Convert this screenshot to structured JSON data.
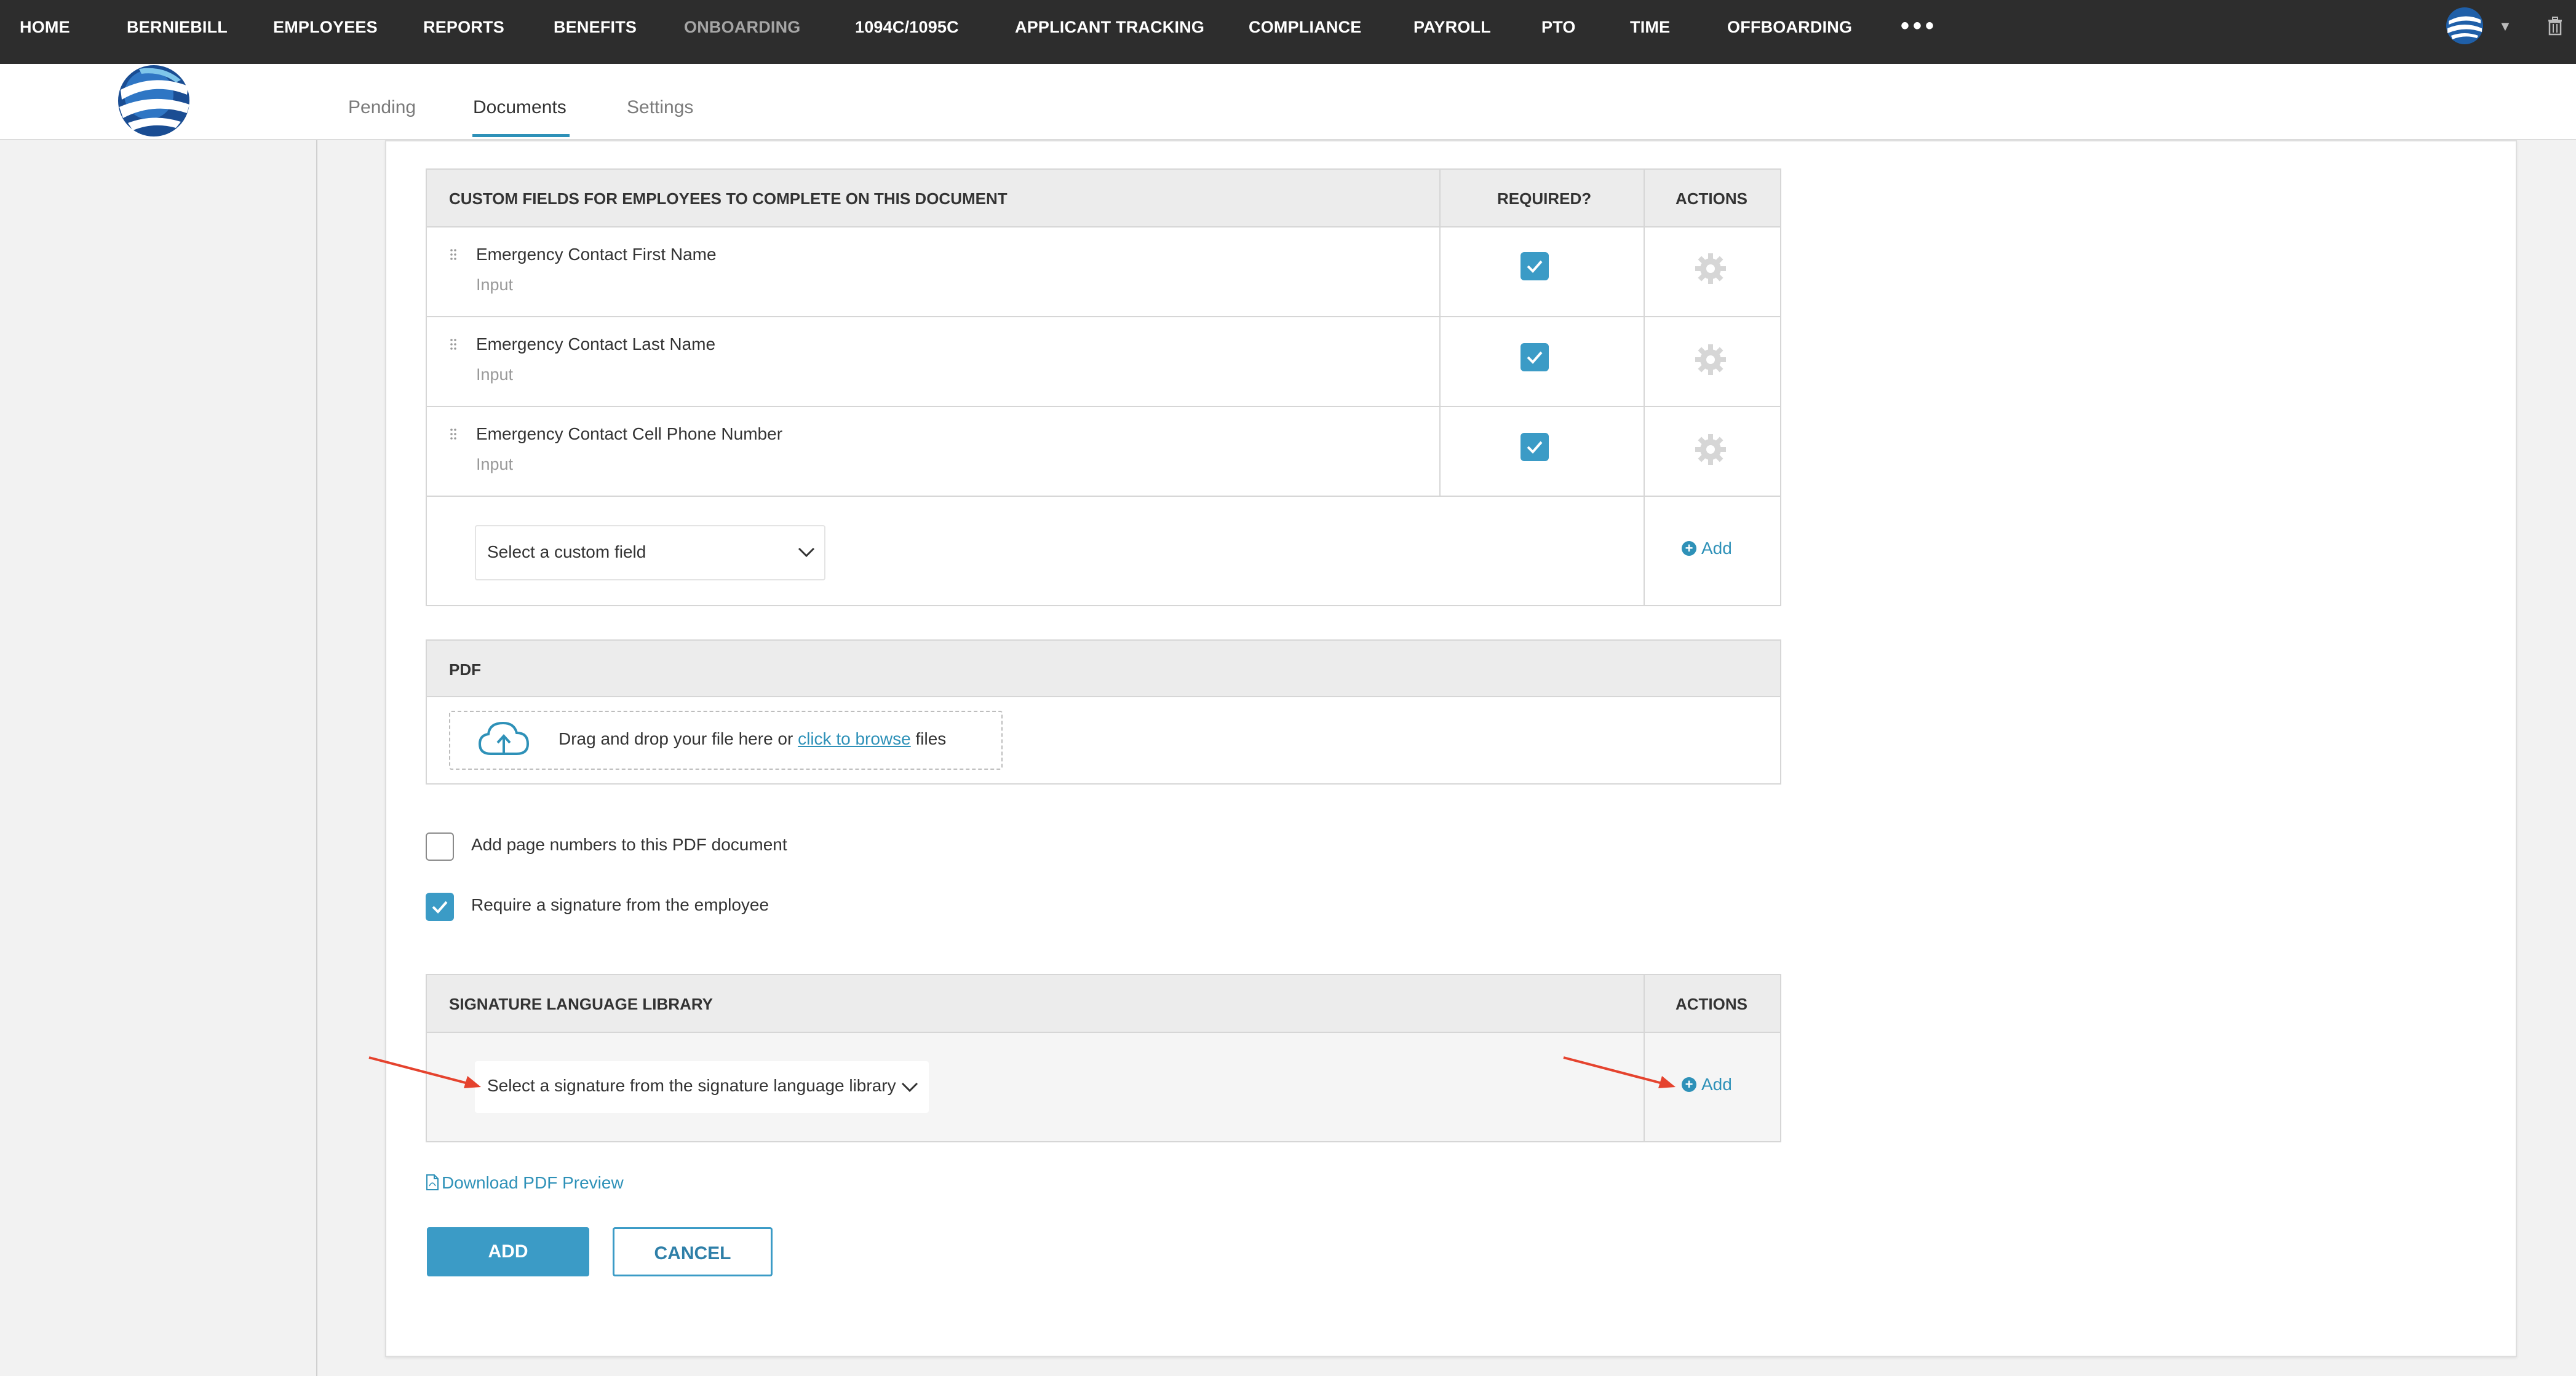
{
  "nav": {
    "items": [
      {
        "label": "HOME"
      },
      {
        "label": "BERNIEBILL"
      },
      {
        "label": "EMPLOYEES"
      },
      {
        "label": "REPORTS"
      },
      {
        "label": "BENEFITS"
      },
      {
        "label": "ONBOARDING"
      },
      {
        "label": "1094C/1095C"
      },
      {
        "label": "APPLICANT TRACKING"
      },
      {
        "label": "COMPLIANCE"
      },
      {
        "label": "PAYROLL"
      },
      {
        "label": "PTO"
      },
      {
        "label": "TIME"
      },
      {
        "label": "OFFBOARDING"
      }
    ],
    "more": "•••",
    "active_item": "ONBOARDING"
  },
  "tabs": [
    {
      "label": "Pending"
    },
    {
      "label": "Documents"
    },
    {
      "label": "Settings"
    }
  ],
  "active_tab": "Documents",
  "custom_fields": {
    "header": "CUSTOM FIELDS FOR EMPLOYEES TO COMPLETE ON THIS DOCUMENT",
    "required_header": "REQUIRED?",
    "actions_header": "ACTIONS",
    "rows": [
      {
        "name": "Emergency Contact First Name",
        "type": "Input",
        "required": true
      },
      {
        "name": "Emergency Contact Last Name",
        "type": "Input",
        "required": true
      },
      {
        "name": "Emergency Contact Cell Phone Number",
        "type": "Input",
        "required": true
      }
    ],
    "select_placeholder": "Select a custom field",
    "add_label": "Add"
  },
  "pdf": {
    "header": "PDF",
    "drop_text": "Drag and drop your file here or",
    "browse_link": "click to browse",
    "drop_suffix": "files"
  },
  "options": {
    "page_numbers_label": "Add page numbers to this PDF document",
    "page_numbers_checked": false,
    "signature_label": "Require a signature from the employee",
    "signature_checked": true
  },
  "signature_library": {
    "header": "SIGNATURE LANGUAGE LIBRARY",
    "actions_header": "ACTIONS",
    "select_placeholder": "Select a signature from the signature language library",
    "add_label": "Add"
  },
  "download_preview": "Download PDF Preview",
  "buttons": {
    "add": "ADD",
    "cancel": "CANCEL"
  },
  "colors": {
    "accent": "#3b9bc6",
    "nav_bg": "#2d2d2d",
    "annotation_arrow": "#e5432e"
  }
}
